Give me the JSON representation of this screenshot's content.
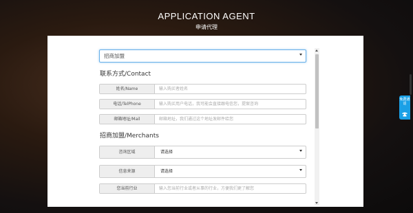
{
  "header": {
    "title": "APPLICATION AGENT",
    "subtitle": "申请代理"
  },
  "form": {
    "type_select": {
      "value": "招商加盟"
    },
    "contact_section": "联系方式/Contact",
    "fields": {
      "name": {
        "label": "姓名/Name",
        "placeholder": "输入购买者姓名"
      },
      "phone": {
        "label": "电话/TelPhone",
        "placeholder": "输入购买用户电话，我可能会直接跟电信您，提案咨询"
      },
      "mail": {
        "label": "邮箱地址/Mail",
        "placeholder": "邮箱地址，我们通过这个地址发邮件给您"
      }
    },
    "merchants_section": "招商加盟/Merchants",
    "merchant_fields": {
      "area": {
        "label": "咨询区域",
        "value": "请选择"
      },
      "source": {
        "label": "信息来源",
        "value": "请选择"
      },
      "industry": {
        "label": "您当前行业",
        "placeholder": "输入您当前行业或者从事的行业，方便我们更了解您"
      }
    }
  },
  "float_widget": {
    "text": "免费通话",
    "icon": "phone-icon"
  }
}
